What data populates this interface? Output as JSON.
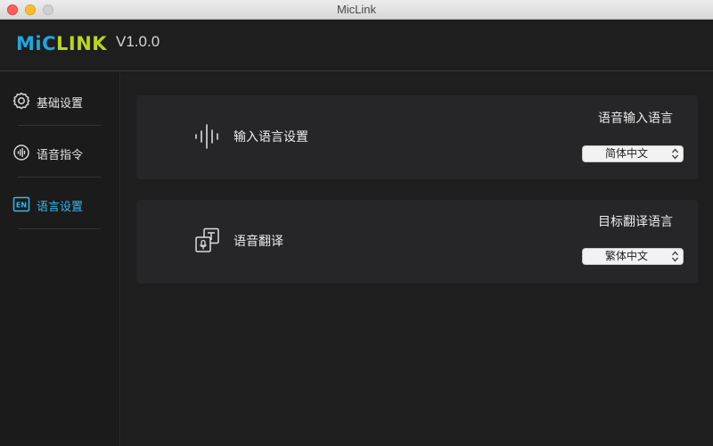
{
  "window": {
    "title": "MicLink"
  },
  "header": {
    "logo_mic": "MiC",
    "logo_link": "LINK",
    "version": "V1.0.0"
  },
  "sidebar": {
    "items": [
      {
        "label": "基础设置",
        "icon": "gear-icon",
        "active": false
      },
      {
        "label": "语音指令",
        "icon": "voice-command-icon",
        "active": false
      },
      {
        "label": "语言设置",
        "icon": "en-language-icon",
        "active": true
      }
    ]
  },
  "cards": {
    "input_language": {
      "title": "输入语言设置",
      "icon": "waveform-icon",
      "right_label": "语音输入语言",
      "selected": "简体中文"
    },
    "translation": {
      "title": "语音翻译",
      "icon": "translate-icon",
      "right_label": "目标翻译语言",
      "selected": "繁体中文"
    }
  },
  "colors": {
    "accent": "#36b6e8",
    "logo_mic": "#1fa7e0",
    "logo_link": "#b8d61f"
  }
}
